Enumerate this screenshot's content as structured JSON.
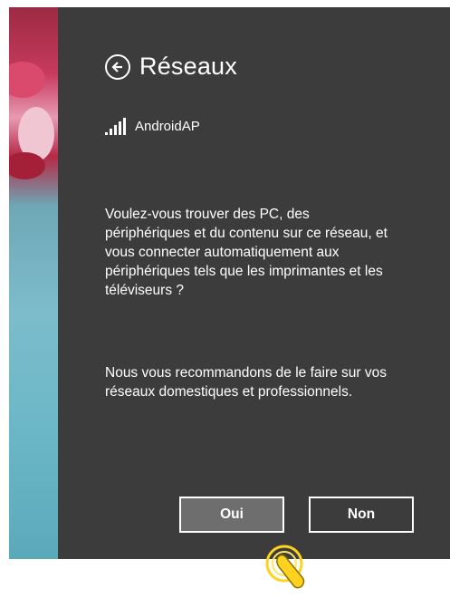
{
  "panel": {
    "title": "Réseaux",
    "network_name": "AndroidAP",
    "question": "Voulez-vous trouver des PC, des périphériques et du contenu sur ce réseau, et vous connecter automatiquement aux périphériques tels que les imprimantes et les téléviseurs ?",
    "recommendation": "Nous vous recommandons de le faire sur vos réseaux domestiques et professionnels.",
    "yes_label": "Oui",
    "no_label": "Non",
    "icons": {
      "back": "back-arrow-circle-icon",
      "signal": "wifi-signal-bars-icon",
      "cursor": "touch-pointer-icon"
    }
  },
  "colors": {
    "panel_bg": "#3c3c3c",
    "selected_button_bg": "#6e6e6e",
    "text": "#ffffff",
    "cursor_fill": "#ffd21f"
  }
}
